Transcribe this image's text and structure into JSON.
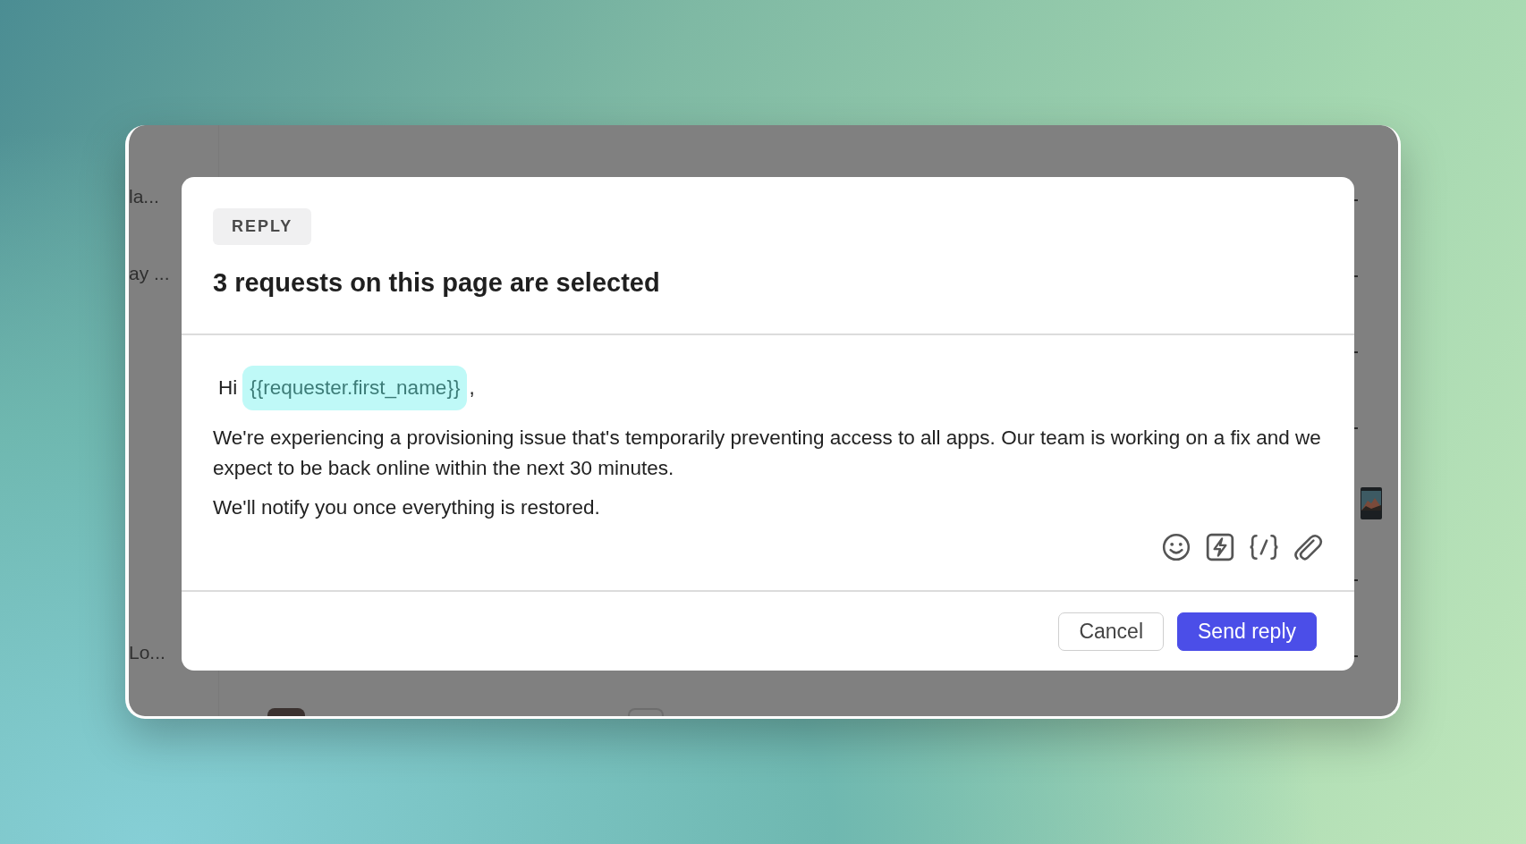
{
  "background_rows": [
    {
      "left_text": "la..."
    },
    {
      "left_text": "ay ..."
    },
    {
      "left_text": "Lo..."
    }
  ],
  "modal": {
    "badge": "REPLY",
    "title": "3 requests on this page are selected",
    "greeting": {
      "word": "Hi",
      "token": "{{requester.first_name}}",
      "punctuation": ","
    },
    "paragraphs": [
      "We're experiencing a provisioning issue that's temporarily preventing access to all apps. Our team is working on a fix and we expect to be back online within the next 30 minutes.",
      "We'll notify you once everything is restored."
    ],
    "buttons": [
      {
        "label": "Cancel",
        "kind": "secondary"
      },
      {
        "label": "Send reply",
        "kind": "primary"
      }
    ]
  }
}
